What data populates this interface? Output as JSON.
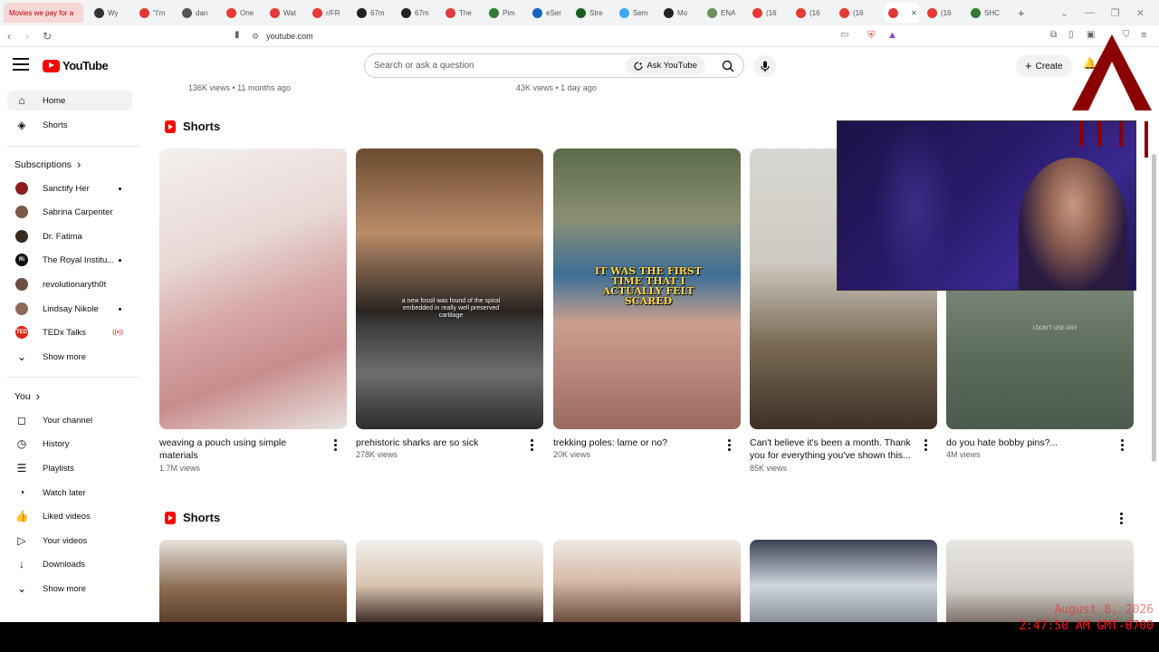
{
  "browser": {
    "tabs": [
      {
        "label": "Movies we pay for a",
        "color": "#e53935"
      },
      {
        "label": "Wy",
        "color": "#333333"
      },
      {
        "label": "\"I'm",
        "color": "#e53935"
      },
      {
        "label": "dan",
        "color": "#555555"
      },
      {
        "label": "One",
        "color": "#e53935"
      },
      {
        "label": "Wat",
        "color": "#e53935"
      },
      {
        "label": "r/FR",
        "color": "#e53935"
      },
      {
        "label": "67m",
        "color": "#222222"
      },
      {
        "label": "67m",
        "color": "#222222"
      },
      {
        "label": "The",
        "color": "#e53935"
      },
      {
        "label": "Pim",
        "color": "#2e7d32"
      },
      {
        "label": "eSer",
        "color": "#1565c0"
      },
      {
        "label": "Stre",
        "color": "#1b5e20"
      },
      {
        "label": "Sem",
        "color": "#42a5f5"
      },
      {
        "label": "Mo",
        "color": "#222222"
      },
      {
        "label": "ENA",
        "color": "#6d8f5b"
      },
      {
        "label": "(16",
        "color": "#e53935"
      },
      {
        "label": "(16",
        "color": "#e53935"
      },
      {
        "label": "(16",
        "color": "#e53935"
      },
      {
        "label": "",
        "color": "#e53935"
      },
      {
        "label": "(16",
        "color": "#e53935"
      },
      {
        "label": "SHC",
        "color": "#2e7d32"
      }
    ],
    "url": "youtube.com"
  },
  "header": {
    "logo_text": "YouTube",
    "search_placeholder": "Search or ask a question",
    "ask_label": "Ask YouTube",
    "create_label": "Create"
  },
  "sidebar": {
    "main": [
      {
        "label": "Home",
        "icon": "home-icon"
      },
      {
        "label": "Shorts",
        "icon": "shorts-icon"
      }
    ],
    "subscriptions_heading": "Subscriptions",
    "subscriptions": [
      {
        "label": "Sanctify Her",
        "color": "#8b1d1d",
        "initials": "",
        "badge": "dot"
      },
      {
        "label": "Sabrina Carpenter",
        "color": "#7a5a4a",
        "initials": "",
        "badge": ""
      },
      {
        "label": "Dr. Fatima",
        "color": "#3a2a22",
        "initials": "",
        "badge": ""
      },
      {
        "label": "The Royal Institu...",
        "color": "#111111",
        "initials": "Ri",
        "badge": "dot"
      },
      {
        "label": "revolutionaryth0t",
        "color": "#6a5040",
        "initials": "",
        "badge": ""
      },
      {
        "label": "Lindsay Nikole",
        "color": "#8a6a5a",
        "initials": "",
        "badge": "dot"
      },
      {
        "label": "TEDx Talks",
        "color": "#e62117",
        "initials": "TED",
        "badge": "live"
      }
    ],
    "show_more_1": "Show more",
    "you_heading": "You",
    "you_items": [
      {
        "label": "Your channel",
        "icon": "channel-icon"
      },
      {
        "label": "History",
        "icon": "history-icon"
      },
      {
        "label": "Playlists",
        "icon": "playlists-icon"
      },
      {
        "label": "Watch later",
        "icon": "watch-later-icon"
      },
      {
        "label": "Liked videos",
        "icon": "thumbs-up-icon"
      },
      {
        "label": "Your videos",
        "icon": "your-videos-icon"
      },
      {
        "label": "Downloads",
        "icon": "download-icon"
      }
    ],
    "show_more_2": "Show more",
    "live_glyph": "((•))"
  },
  "main": {
    "top_meta": [
      "136K views • 11 months ago",
      "43K views • 1 day ago"
    ],
    "shelf1": {
      "title": "Shorts",
      "items": [
        {
          "title": "weaving a pouch using simple materials",
          "views": "1.7M views",
          "bg": "linear-gradient(160deg,#f4f1ee 0%,#e8d8d6 35%,#d7a9a8 55%,#c98c8c 75%,#e7e2df 100%)",
          "overlay": ""
        },
        {
          "title": "prehistoric sharks are so sick",
          "views": "278K views",
          "bg": "linear-gradient(180deg,#6b4b2f 0%,#b98d6a 30%,#2a2421 58%,#3a3a3a 62%,#6e6e6e 80%,#2c2c2c 100%)",
          "overlay": "a new fossil was found of the spiral embedded in really well preserved cartilage"
        },
        {
          "title": "trekking poles: lame or no?",
          "views": "20K views",
          "bg": "linear-gradient(180deg,#5b6a4a 0%,#8a8f73 25%,#3d6f98 45%,#c9a08d 62%,#b8857a 80%,#9a6a5e 100%)",
          "overlay": "IT WAS THE FIRST TIME THAT I ACTUALLY FELT SCARED"
        },
        {
          "title": "Can't believe it's been a month. Thank you for everything you've shown this...",
          "views": "85K views",
          "bg": "linear-gradient(180deg,#d8d7d2 0%,#cfcac2 40%,#7a6a55 70%,#3e2f26 100%)",
          "overlay": ""
        },
        {
          "title": "do you hate bobby pins?...",
          "views": "4M views",
          "bg": "linear-gradient(180deg,#dad6d1 0%,#7e8a7a 45%,#5a6b5c 75%,#4a5a4c 100%)",
          "overlay": "I DON'T USE ANY"
        }
      ]
    },
    "shelf2": {
      "title": "Shorts",
      "items": [
        {
          "bg": "linear-gradient(180deg,#e6e1da 0%,#8a6a4f 60%,#5a3e2c 100%)"
        },
        {
          "bg": "linear-gradient(180deg,#f3f1ee 0%,#d9c3b0 55%,#3a2a22 100%)"
        },
        {
          "bg": "linear-gradient(180deg,#efe9e3 0%,#d7b9a8 50%,#6a4a3a 100%)"
        },
        {
          "bg": "linear-gradient(180deg,#3b4152 0%,#cfd6df 55%,#8a8f98 100%)"
        },
        {
          "bg": "linear-gradient(180deg,#e9e6e2 0%,#d2cdc8 60%,#7a6f66 100%)"
        }
      ]
    }
  },
  "overlay": {
    "date": "August 8, 2026",
    "time": "2:47:50 AM GMT-0700"
  }
}
